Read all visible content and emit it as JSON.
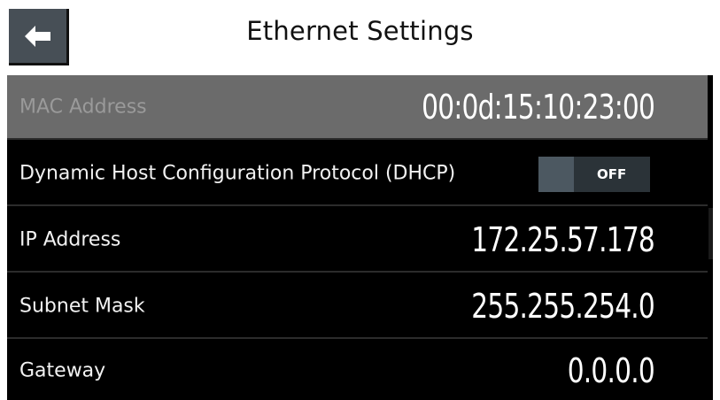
{
  "header": {
    "title": "Ethernet Settings",
    "back_icon": "arrow-left-icon"
  },
  "settings": {
    "mac": {
      "label": "MAC Address",
      "value": "00:0d:15:10:23:00",
      "disabled": true
    },
    "dhcp": {
      "label": "Dynamic Host Configuration Protocol (DHCP)",
      "toggle_state": "OFF"
    },
    "ip": {
      "label": "IP Address",
      "value": "172.25.57.178"
    },
    "subnet": {
      "label": "Subnet Mask",
      "value": "255.255.254.0"
    },
    "gateway": {
      "label": "Gateway",
      "value": "0.0.0.0"
    }
  },
  "colors": {
    "header_bg": "#ffffff",
    "list_bg": "#000000",
    "disabled_row_bg": "#6b6b6b",
    "back_button_bg": "#474f56",
    "toggle_bg": "#2b3338"
  }
}
